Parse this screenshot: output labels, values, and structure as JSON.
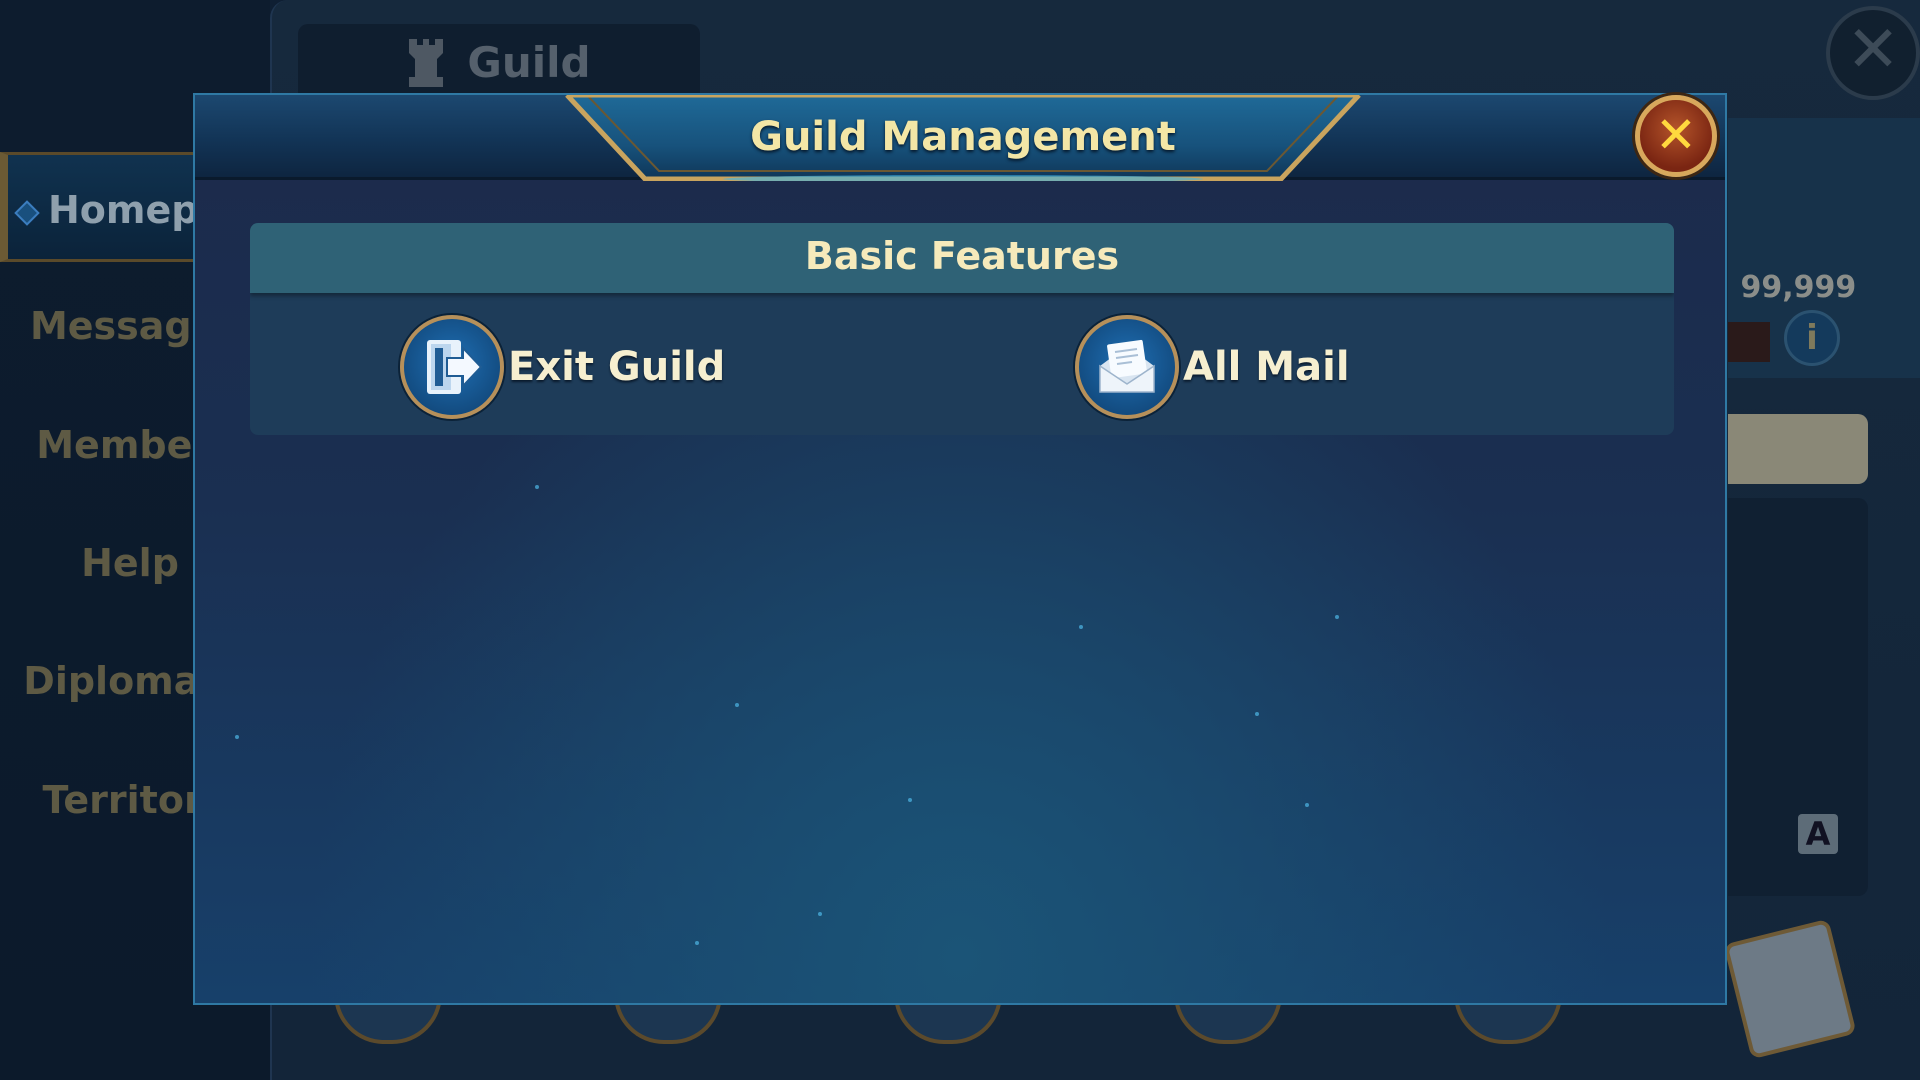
{
  "background": {
    "tab_title": "Guild",
    "sidebar": [
      {
        "label": "Homepage",
        "active": true
      },
      {
        "label": "Messages",
        "active": false
      },
      {
        "label": "Members",
        "active": false
      },
      {
        "label": "Help",
        "active": false
      },
      {
        "label": "Diplomacy",
        "active": false
      },
      {
        "label": "Territory",
        "active": false
      }
    ],
    "stat_text": ": 99,999",
    "info_label": "i",
    "translate_label": "A",
    "close_glyph": "✕"
  },
  "modal": {
    "title": "Guild Management",
    "close_glyph": "✕",
    "section": {
      "title": "Basic Features",
      "features": [
        {
          "label": "Exit Guild",
          "icon": "exit-door-icon"
        },
        {
          "label": "All Mail",
          "icon": "mail-envelope-icon"
        }
      ]
    }
  },
  "colors": {
    "title_text": "#f3e6a6",
    "section_header_bg": "#2f6276",
    "gold_border": "#c9a45e",
    "close_button": "#a8421f"
  }
}
